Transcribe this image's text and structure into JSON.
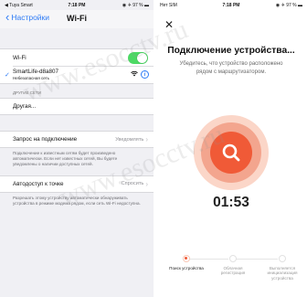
{
  "left": {
    "status": {
      "carrier": "◀ Tuya Smart",
      "time": "7:18 PM",
      "battery": "◉ ✈ 97 % ▬"
    },
    "nav": {
      "back_label": "Настройки",
      "title": "Wi-Fi"
    },
    "wifi_toggle": {
      "label": "Wi-Fi",
      "on": true
    },
    "connected_network": {
      "name": "SmartLife-d8a807",
      "subtitle": "Небезопасная сеть",
      "info": "i"
    },
    "other_networks": {
      "header": "ДРУГИЕ СЕТИ",
      "other_label": "Другая..."
    },
    "ask_to_join": {
      "label": "Запрос на подключение",
      "value": "Уведомлять",
      "footnote": "Подключение к известным сетям будет произведено автоматически. Если нет известных сетей, Вы будете уведомлены о наличии доступных сетей."
    },
    "auto_hotspot": {
      "label": "Автодоступ к точке",
      "value": "Спросить",
      "footnote": "Разрешать этому устройству автоматически обнаруживать устройства в режиме модема рядом, если сеть Wi-Fi недоступна."
    }
  },
  "right": {
    "status": {
      "carrier": "Нет SIM",
      "time": "7:18 PM",
      "battery": "◉ ✈ 97 % ▬"
    },
    "close_icon": "close-icon",
    "title": "Подключение устройства...",
    "description": "Убедитесь, что устройство расположено рядом с маршрутизатором.",
    "timer": "01:53",
    "steps": [
      {
        "label": "Поиск устройства",
        "active": true
      },
      {
        "label": "Облачная регистрация",
        "active": false
      },
      {
        "label": "Выполняется инициализация устройства",
        "active": false
      }
    ],
    "colors": {
      "accent": "#f05a37",
      "ring_outer": "#fbd6c8",
      "ring_inner": "#f3a58e",
      "toggle_on": "#4cd964",
      "link_blue": "#2f7cf6"
    }
  },
  "watermark": "www.esocctv.ru"
}
